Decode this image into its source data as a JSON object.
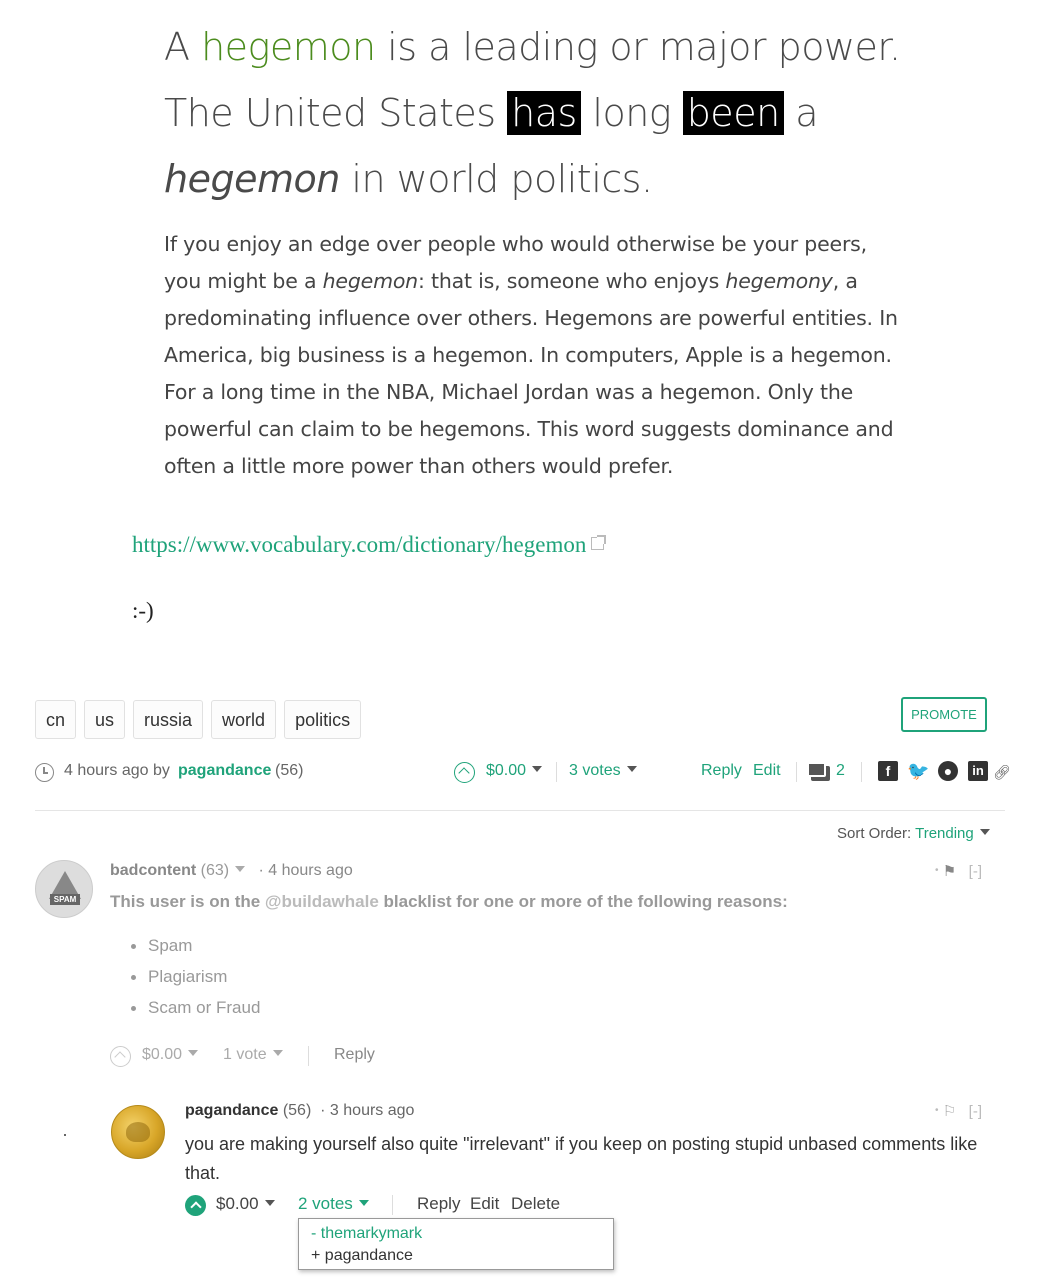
{
  "quote": {
    "p1": "A ",
    "hegemon_word": "hegemon",
    "p2": " is a leading or major power. The United States ",
    "has": "has",
    "p3": " long ",
    "been": "been",
    "p4": " a ",
    "hegemon_italic": "hegemon",
    "p5": " in world politics."
  },
  "description": {
    "t1": "If you enjoy an edge over people who would otherwise be your peers, you might be a ",
    "e1": "hegemon",
    "t2": ": that is, someone who enjoys ",
    "e2": "hegemony",
    "t3": ", a predominating influence over others. Hegemons are powerful entities. In America, big business is a hegemon. In computers, Apple is a hegemon. For a long time in the NBA, Michael Jordan was a hegemon. Only the powerful can claim to be hegemons. This word suggests dominance and often a little more power than others would prefer."
  },
  "link": "https://www.vocabulary.com/dictionary/hegemon",
  "smiley": ":-)",
  "tags": [
    "cn",
    "us",
    "russia",
    "world",
    "politics"
  ],
  "promote_label": "PROMOTE",
  "post_meta": {
    "time": "4 hours ago by",
    "author": "pagandance",
    "reputation": "(56)",
    "payout": "$0.00",
    "votes": "3 votes",
    "reply": "Reply",
    "edit": "Edit",
    "comment_count": "2"
  },
  "sort": {
    "label": "Sort Order:",
    "value": "Trending"
  },
  "comment1": {
    "avatar_text": "SPAM",
    "author": "badcontent",
    "reputation": "(63)",
    "time": "· 4 hours ago",
    "body_prefix": "This user is on the ",
    "mention": "@buildawhale",
    "body_suffix": " blacklist for one or more of the following reasons:",
    "reasons": [
      "Spam",
      "Plagiarism",
      "Scam or Fraud"
    ],
    "payout": "$0.00",
    "votes": "1 vote",
    "reply": "Reply",
    "collapse": "[-]"
  },
  "comment2": {
    "author": "pagandance",
    "reputation": "(56)",
    "time": "· 3 hours ago",
    "body": "you are making yourself also quite \"irrelevant\" if you keep on posting stupid unbased comments like that.",
    "payout": "$0.00",
    "votes": "2 votes",
    "reply": "Reply",
    "edit": "Edit",
    "delete": "Delete",
    "collapse": "[-]",
    "voters": [
      "- themarkymark",
      "+ pagandance"
    ]
  },
  "colors": {
    "accent": "#1fa37a",
    "hegemon_green": "#4c8c1e",
    "text": "#333333"
  }
}
